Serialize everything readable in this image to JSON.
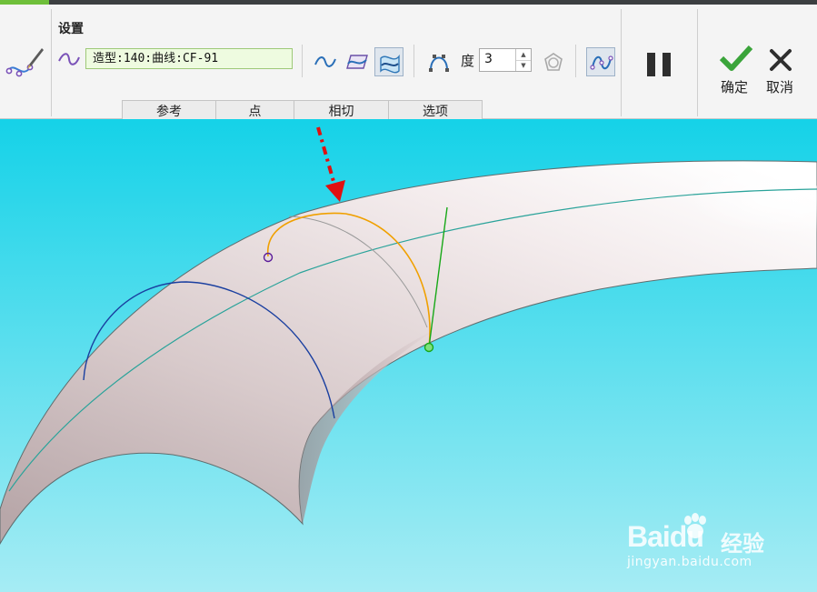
{
  "ribbon": {
    "title": "设置",
    "curve_field_value": "造型:140:曲线:CF-91",
    "degree_label": "度",
    "degree_value": "3",
    "ok_label": "确定",
    "cancel_label": "取消"
  },
  "tabs": [
    {
      "label": "参考"
    },
    {
      "label": "点"
    },
    {
      "label": "相切"
    },
    {
      "label": "选项"
    }
  ],
  "icons": {
    "tool": "curve-edit-tool-icon",
    "curve": "curve-wave-icon",
    "free_curve": "free-curve-icon",
    "plane_curve": "planar-curve-icon",
    "cos_curve": "surface-curve-icon",
    "control_point": "control-point-icon",
    "interp": "interpolate-icon",
    "shape": "shape-handle-icon",
    "pause": "pause-icon",
    "ok": "checkmark-icon",
    "cancel": "close-icon"
  },
  "colors": {
    "accent_green": "#6fbf3a",
    "viewport_top": "#15d2e8",
    "viewport_bottom": "#a6ecf4",
    "field_bg": "#eefbe0",
    "ok_green": "#3aa43a"
  },
  "watermark": {
    "brand": "Bai",
    "brand_du": "du",
    "cn": "经验",
    "url": "jingyan.baidu.com"
  }
}
